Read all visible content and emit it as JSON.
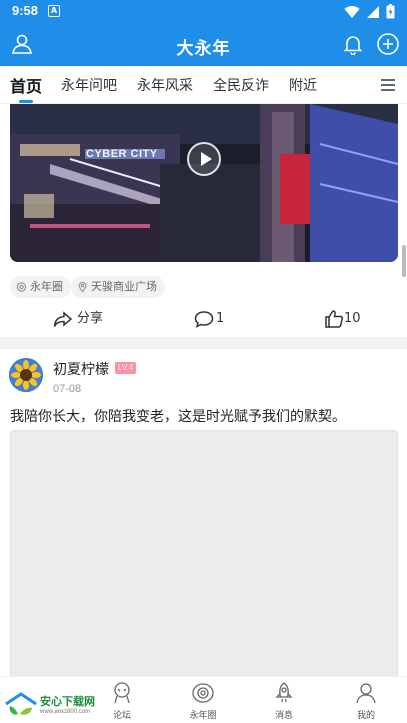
{
  "status_bar": {
    "time": "9:58",
    "notification_letter": "A"
  },
  "header": {
    "title": "大永年"
  },
  "tabs": [
    {
      "label": "首页",
      "active": true
    },
    {
      "label": "永年问吧",
      "active": false
    },
    {
      "label": "永年风采",
      "active": false
    },
    {
      "label": "全民反诈",
      "active": false
    },
    {
      "label": "附近",
      "active": false
    }
  ],
  "post1": {
    "video_sign_text": "CYBER CITY",
    "tags": [
      "永年圈",
      "天骏商业广场"
    ],
    "actions": {
      "share_label": "分享",
      "comment_count": "1",
      "like_count": "10"
    }
  },
  "post2": {
    "username": "初夏柠檬",
    "level": "LV.4",
    "date": "07-08",
    "text": "我陪你长大，你陪我变老，这是时光赋予我们的默契。"
  },
  "bottom_nav": [
    {
      "label": "论坛",
      "icon": "forum-icon"
    },
    {
      "label": "永年圈",
      "icon": "circle-icon"
    },
    {
      "label": "消息",
      "icon": "rocket-icon"
    },
    {
      "label": "我的",
      "icon": "profile-icon"
    }
  ],
  "watermark": {
    "title": "安心下载网",
    "url": "www.anxz800.com"
  },
  "colors": {
    "primary": "#1e8ee8",
    "level_badge": "#ff8fa3",
    "tag_bg": "#f2f2f2"
  }
}
